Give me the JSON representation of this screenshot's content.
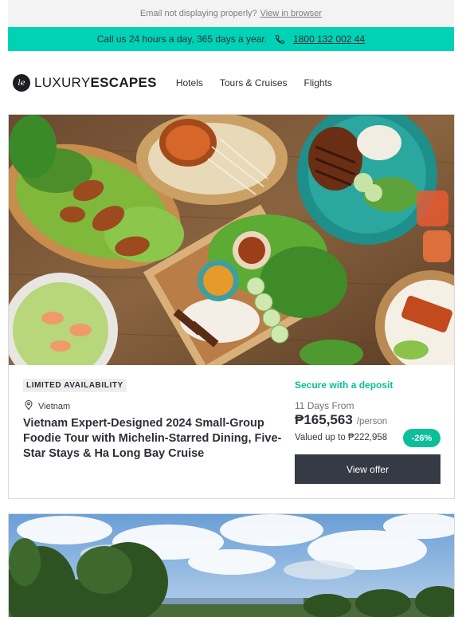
{
  "preheader": {
    "text": "Email not displaying properly?",
    "link": "View in browser"
  },
  "callbar": {
    "text": "Call us 24 hours a day, 365 days a year.",
    "phone": "1800 132 002 44",
    "icon": "phone-icon"
  },
  "header": {
    "logo": {
      "mark": "le",
      "word_light": "LUXURY",
      "word_bold": "ESCAPES"
    },
    "nav": [
      "Hotels",
      "Tours & Cruises",
      "Flights"
    ]
  },
  "offer": {
    "badge": "LIMITED AVAILABILITY",
    "location": "Vietnam",
    "title": "Vietnam Expert-Designed 2024 Small-Group Foodie Tour with Michelin-Starred Dining, Five-Star Stays & Ha Long Bay Cruise",
    "deposit": "Secure with a deposit",
    "days": "11 Days From",
    "price": "₱165,563",
    "per": "/person",
    "valued": "Valued up to ₱222,958",
    "discount": "-26%",
    "cta": "View offer"
  },
  "colors": {
    "accent": "#00d2b6",
    "deposit_green": "#0bbf98",
    "button_dark": "#363a45"
  }
}
